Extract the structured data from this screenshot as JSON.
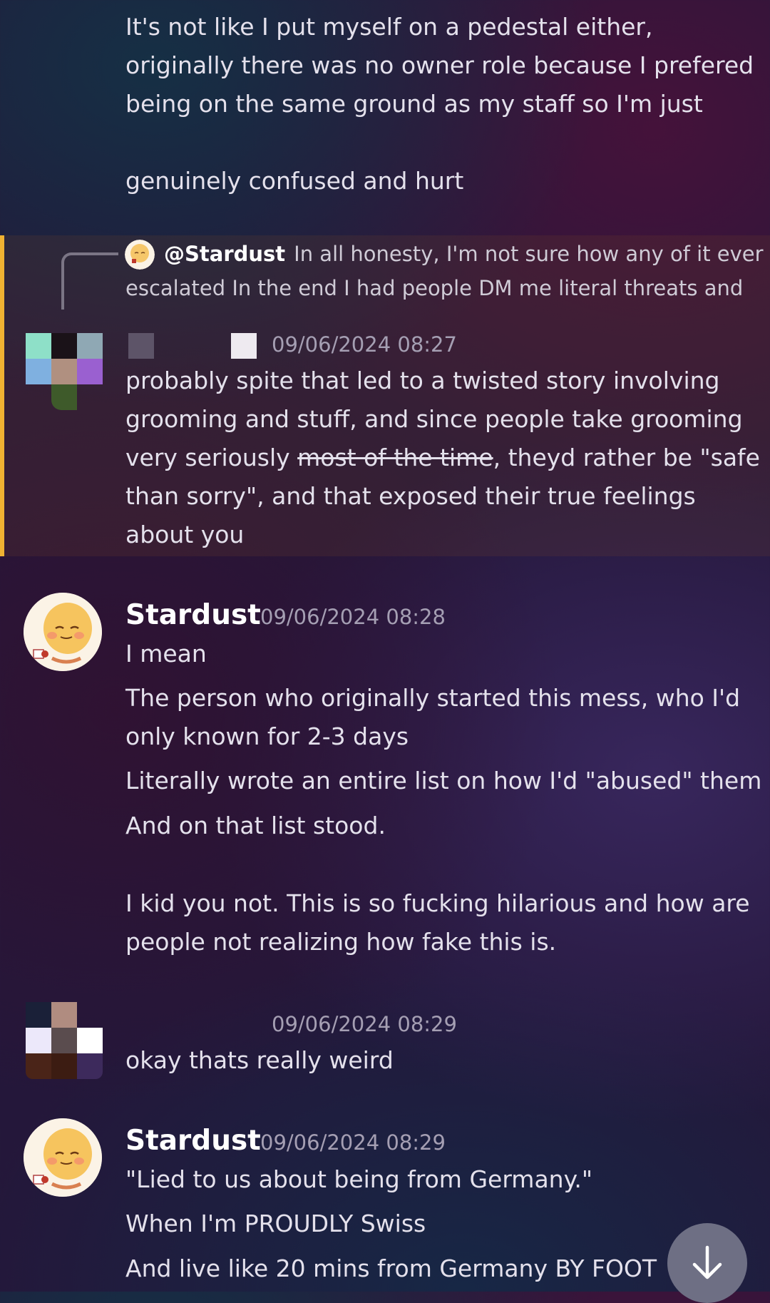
{
  "messages": {
    "m1": {
      "lines": [
        "It's not like I put myself on a pedestal either,",
        "originally there was no owner role because I prefered",
        "being on the same ground as my staff so I'm just",
        "genuinely confused and hurt"
      ]
    },
    "m2": {
      "reply": {
        "mention": "@Stardust",
        "preview_part1": "In all honesty, I'm not sure how any of it ever",
        "preview_part2": "escalated  In the end I had people DM me literal threats and"
      },
      "timestamp": "09/06/2024 08:27",
      "lines": {
        "l1": "probably spite that led to a twisted story involving",
        "l2": "grooming and stuff, and since people take grooming",
        "l3_a": "very seriously ",
        "l3_strike": "most of the time",
        "l3_b": ", theyd rather be \"safe",
        "l4": "than sorry\", and that exposed their true feelings",
        "l5": "about you"
      }
    },
    "m3": {
      "author": "Stardust",
      "timestamp": "09/06/2024 08:28",
      "lines": [
        "I mean",
        "The person who originally started this mess, who I'd",
        "only known for 2-3 days",
        "Literally wrote an entire list on how I'd \"abused\" them",
        "And on that list stood.",
        "I kid you not. This is so fucking hilarious and how are",
        "people not realizing how fake this is."
      ]
    },
    "m4": {
      "timestamp": "09/06/2024 08:29",
      "lines": [
        "okay thats really weird"
      ]
    },
    "m5": {
      "author": "Stardust",
      "timestamp": "09/06/2024 08:29",
      "lines": [
        "\"Lied to us about being from Germany.\"",
        "When I'm PROUDLY Swiss",
        "And live like 20 mins from Germany BY FOOT"
      ]
    }
  },
  "icons": {
    "scroll_button": "arrow-down-icon",
    "stardust_avatar": "cartoon-face-avatar",
    "censored_avatar": "pixelated-avatar"
  },
  "colors": {
    "highlight_bar": "#f0b232",
    "timestamp": "#a59fb3",
    "name": "#ffffff"
  }
}
